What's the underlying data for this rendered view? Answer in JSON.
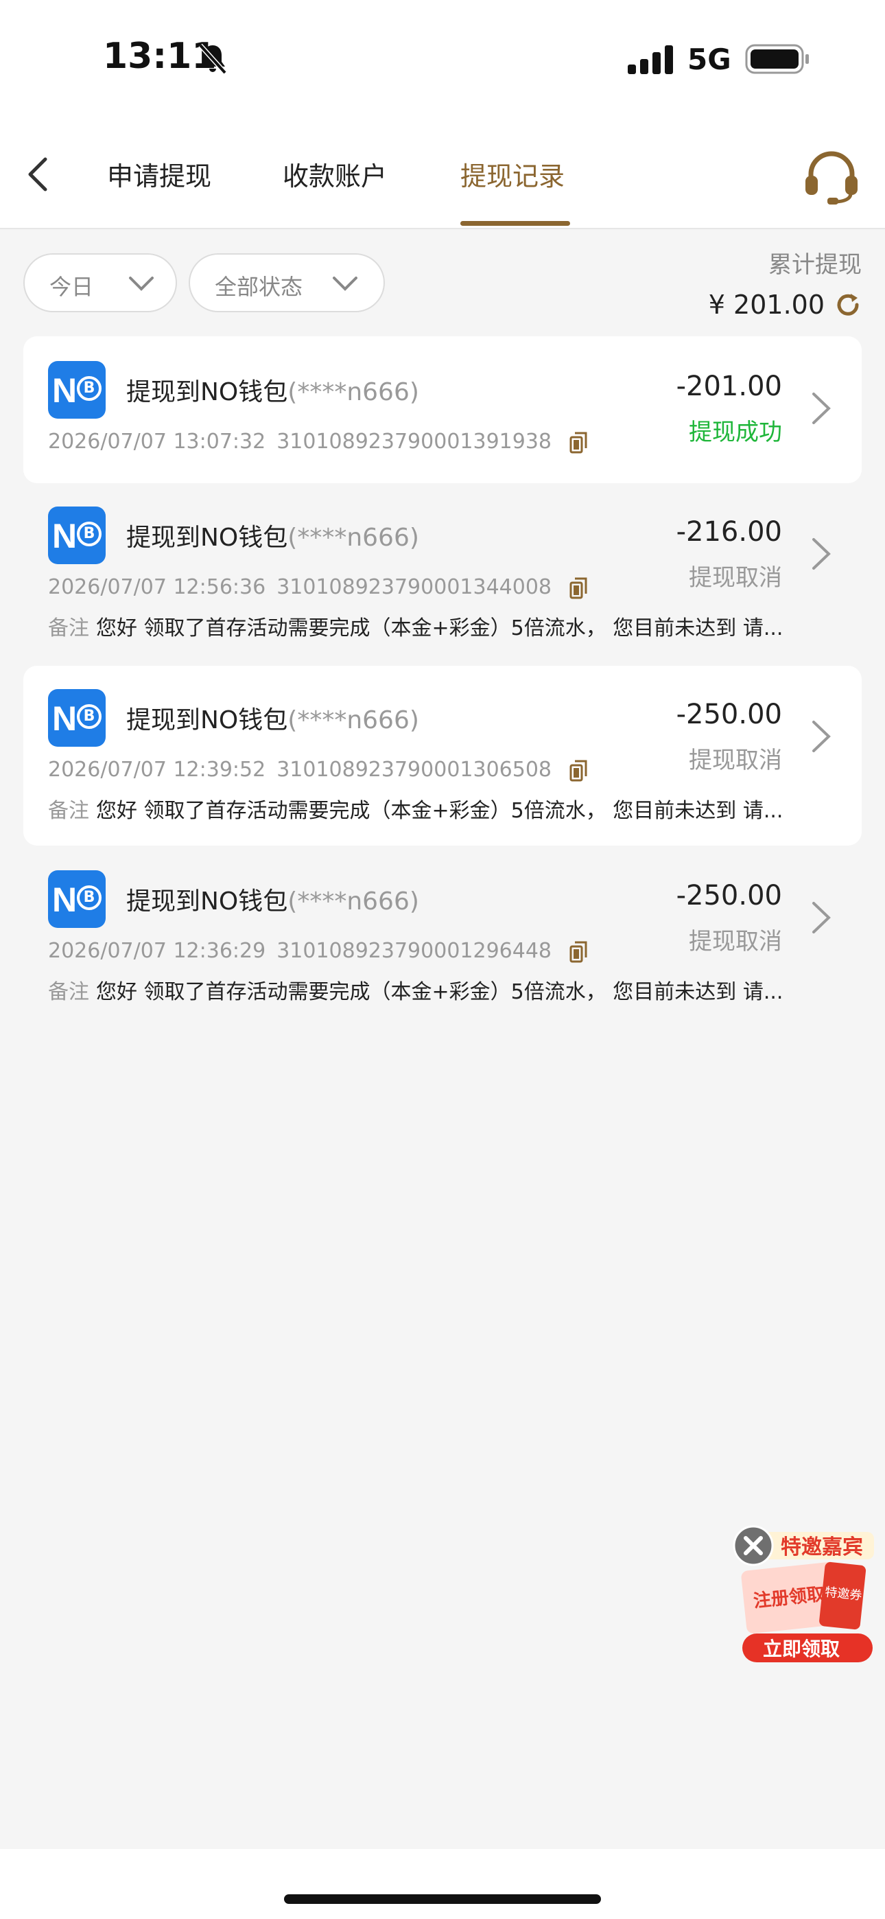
{
  "status_bar": {
    "time": "13:11",
    "network": "5G"
  },
  "nav": {
    "tabs": [
      {
        "label": "申请提现",
        "active": false
      },
      {
        "label": "收款账户",
        "active": false
      },
      {
        "label": "提现记录",
        "active": true
      }
    ]
  },
  "filters": {
    "date": "今日",
    "status": "全部状态"
  },
  "summary": {
    "label": "累计提现",
    "amount": "¥ 201.00"
  },
  "records": [
    {
      "title": "提现到NO钱包",
      "account": "(****n666)",
      "datetime": "2026/07/07 13:07:32",
      "order_no": "310108923790001391938",
      "amount": "-201.00",
      "status": "提现成功",
      "remark_label": "",
      "remark": ""
    },
    {
      "title": "提现到NO钱包",
      "account": "(****n666)",
      "datetime": "2026/07/07 12:56:36",
      "order_no": "310108923790001344008",
      "amount": "-216.00",
      "status": "提现取消",
      "remark_label": "备注",
      "remark": "您好 领取了首存活动需要完成（本金+彩金）5倍流水， 您目前未达到 请..."
    },
    {
      "title": "提现到NO钱包",
      "account": "(****n666)",
      "datetime": "2026/07/07 12:39:52",
      "order_no": "310108923790001306508",
      "amount": "-250.00",
      "status": "提现取消",
      "remark_label": "备注",
      "remark": "您好 领取了首存活动需要完成（本金+彩金）5倍流水， 您目前未达到 请..."
    },
    {
      "title": "提现到NO钱包",
      "account": "(****n666)",
      "datetime": "2026/07/07 12:36:29",
      "order_no": "310108923790001296448",
      "amount": "-250.00",
      "status": "提现取消",
      "remark_label": "备注",
      "remark": "您好 领取了首存活动需要完成（本金+彩金）5倍流水， 您目前未达到 请..."
    }
  ],
  "promo": {
    "banner_text": "特邀嘉宾",
    "card_text": "注册领取",
    "tag_text": "特邀券",
    "button": "立即领取"
  },
  "colors": {
    "accent": "#8b6630",
    "success": "#1fb63a",
    "wallet_blue": "#1f7de6"
  },
  "icons": [
    "back-icon",
    "headset-icon",
    "chevron-down-icon",
    "refresh-icon",
    "copy-icon",
    "chevron-right-icon",
    "close-icon",
    "bell-slash-icon"
  ]
}
